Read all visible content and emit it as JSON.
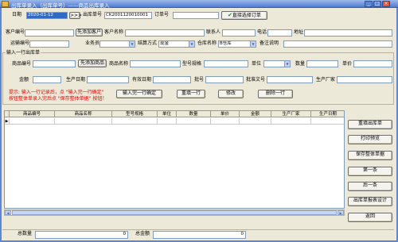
{
  "window": {
    "title": "出库单录入（出库单号）——商品出库录入"
  },
  "row1": {
    "date_label": "日期",
    "date_value": "2020-01-12",
    "date_nav": ">>>",
    "outno_label": "出库单号",
    "outno_value": "CK2001120010001",
    "orderno_label": "订单号",
    "orderno_value": "",
    "select_order_label": "直接选择订单",
    "check_icon": "✔"
  },
  "row2": {
    "customer_no_label": "客户编号",
    "add_customer_label": "先添加客户",
    "customer_name_label": "客户名称",
    "contact_label": "联系人",
    "phone_label": "电话",
    "address_label": "地址"
  },
  "row3": {
    "carrier_label": "运输编号",
    "salesman_label": "业务员",
    "settle_label": "结算方式",
    "settle_value": "现金",
    "warehouse_label": "仓库名称",
    "warehouse_value": "B仓库",
    "remark_label": "备注说明"
  },
  "entry_group": {
    "title": "输入一行出库单",
    "product_no_label": "商品编号",
    "add_product_label": "先添加商品",
    "product_name_label": "商品名称",
    "model_label": "型号规格",
    "unit_label": "单位",
    "qty_label": "数量",
    "price_label": "单价",
    "amount_label": "金额",
    "prod_date_label": "生产日期",
    "expiry_label": "有效日期",
    "batch_label": "批号",
    "approval_label": "批准文号",
    "maker_label": "生产厂家",
    "hint_line1": "提示: 输入一行记录后，点 \"输入完一行确定\"",
    "hint_line2": "按钮整体单录入完后点 \"保存整体单据\" 按钮！",
    "confirm_row_label": "输入完一行确定",
    "reinput_label": "重填一行",
    "modify_label": "修改",
    "delete_label": "删除一行"
  },
  "grid": {
    "columns": [
      "商品编号",
      "商品名称",
      "型号规格",
      "单位",
      "数量",
      "单价",
      "金额",
      "生产厂家",
      "生产日期"
    ]
  },
  "side": {
    "refill_label": "重填出库单",
    "print_preview_label": "打印预览",
    "save_label": "保存整体单据",
    "first_label": "第一条",
    "last_label": "后一条",
    "designer_label": "出库单报表设计",
    "back_label": "返回"
  },
  "status": {
    "total_qty_label": "总数量",
    "total_qty_value": "0",
    "total_amount_label": "总金额",
    "total_amount_value": "0"
  },
  "colors": {
    "titlebar": "#4f7bd1",
    "hint": "#e80000",
    "selected": "#316ac5",
    "window_bg": "#ece9d8"
  }
}
